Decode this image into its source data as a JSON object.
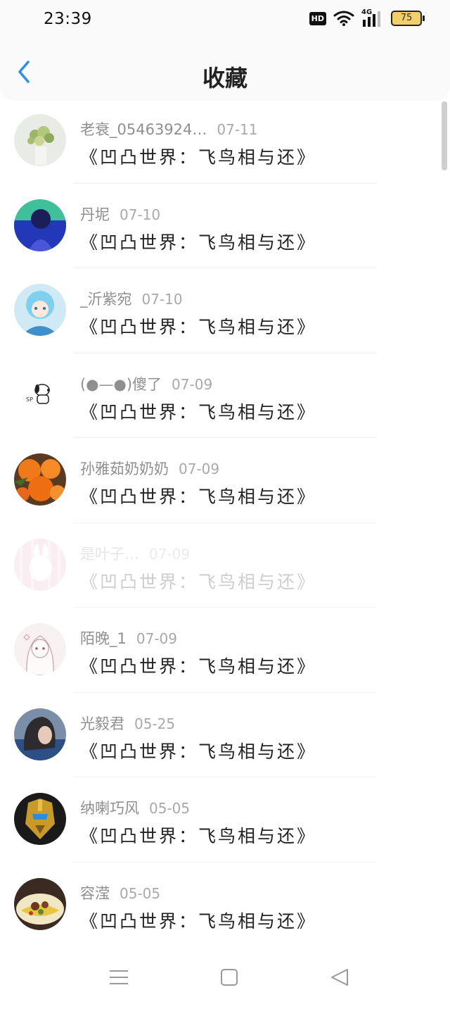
{
  "status_bar": {
    "time": "23:39",
    "hd_label": "HD",
    "network_label": "4G",
    "battery_level": "75"
  },
  "header": {
    "title": "收藏",
    "back_icon": "chevron-left-icon",
    "accent_color": "#2f8fe0"
  },
  "items": [
    {
      "user": "老衰_05463924…",
      "date": "07-11",
      "work": "《凹凸世界：飞鸟相与还》",
      "avatar": "flowers"
    },
    {
      "user": "丹坭",
      "date": "07-10",
      "work": "《凹凸世界：飞鸟相与还》",
      "avatar": "blue-anime"
    },
    {
      "user": "_沂紫宛",
      "date": "07-10",
      "work": "《凹凸世界：飞鸟相与还》",
      "avatar": "cyan-anime"
    },
    {
      "user": "(●—●)傻了",
      "date": "07-09",
      "work": "《凹凸世界：飞鸟相与还》",
      "avatar": "snoopy"
    },
    {
      "user": "孙雅茹奶奶奶",
      "date": "07-09",
      "work": "《凹凸世界：飞鸟相与还》",
      "avatar": "marigold"
    },
    {
      "user": "是叶子…",
      "date": "07-09",
      "work": "《凹凸世界：飞鸟相与还》",
      "avatar": "pink-rabbit"
    },
    {
      "user": "陌晚_1",
      "date": "07-09",
      "work": "《凹凸世界：飞鸟相与还》",
      "avatar": "sketch-girl"
    },
    {
      "user": "光毅君",
      "date": "05-25",
      "work": "《凹凸世界：飞鸟相与还》",
      "avatar": "dark-hair"
    },
    {
      "user": "纳喇巧风",
      "date": "05-05",
      "work": "《凹凸世界：飞鸟相与还》",
      "avatar": "robot"
    },
    {
      "user": "容滢",
      "date": "05-05",
      "work": "《凹凸世界：飞鸟相与还》",
      "avatar": "food"
    }
  ],
  "nav": {
    "menu_icon": "menu-icon",
    "home_icon": "home-square-icon",
    "back_icon": "back-triangle-icon"
  }
}
